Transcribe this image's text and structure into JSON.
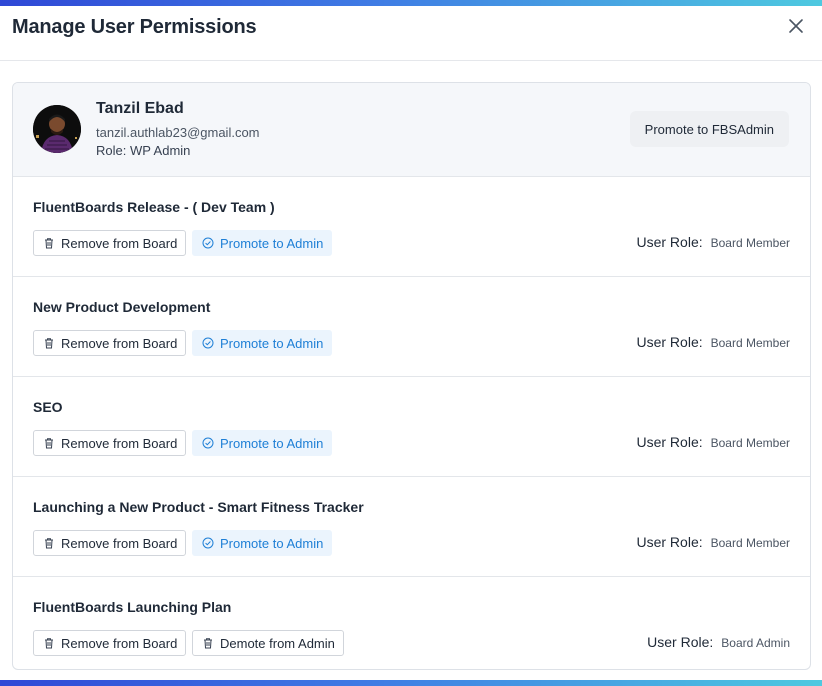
{
  "modal": {
    "title": "Manage User Permissions"
  },
  "user": {
    "name": "Tanzil Ebad",
    "email": "tanzil.authlab23@gmail.com",
    "role": "Role: WP Admin",
    "promote_label": "Promote to FBSAdmin"
  },
  "labels": {
    "user_role": "User Role:"
  },
  "boards": [
    {
      "name": "FluentBoards Release - ( Dev Team )",
      "remove_label": "Remove from Board",
      "action_label": "Promote to Admin",
      "action_type": "promote",
      "role": "Board Member"
    },
    {
      "name": "New Product Development",
      "remove_label": "Remove from Board",
      "action_label": "Promote to Admin",
      "action_type": "promote",
      "role": "Board Member"
    },
    {
      "name": "SEO",
      "remove_label": "Remove from Board",
      "action_label": "Promote to Admin",
      "action_type": "promote",
      "role": "Board Member"
    },
    {
      "name": "Launching a New Product - Smart Fitness Tracker",
      "remove_label": "Remove from Board",
      "action_label": "Promote to Admin",
      "action_type": "promote",
      "role": "Board Member"
    },
    {
      "name": "FluentBoards Launching Plan",
      "remove_label": "Remove from Board",
      "action_label": "Demote from Admin",
      "action_type": "demote",
      "role": "Board Admin"
    }
  ],
  "icons": {
    "close": "close-icon",
    "remove": "trash-icon",
    "promote": "check-circle-icon",
    "demote": "trash-icon"
  },
  "colors": {
    "accent": "#1e7fd6",
    "gradient_start": "#2f48d6",
    "gradient_end": "#4ec9e0"
  }
}
